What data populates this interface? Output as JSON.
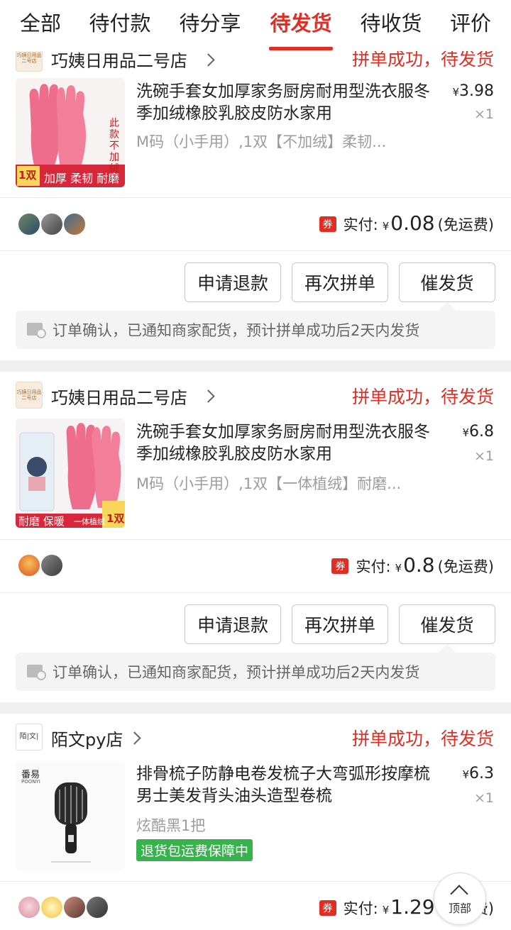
{
  "tabs": [
    {
      "label": "全部"
    },
    {
      "label": "待付款"
    },
    {
      "label": "待分享"
    },
    {
      "label": "待发货"
    },
    {
      "label": "待收货"
    },
    {
      "label": "评价"
    }
  ],
  "active_tab": "待发货",
  "colors": {
    "accent": "#e02e24",
    "guarantee": "#37b24d"
  },
  "orders": [
    {
      "shop_logo": "巧姨日用品二号店",
      "shop_name": "巧姨日用品二号店",
      "status": "拼单成功，待发货",
      "title": "洗碗手套女加厚家务厨房耐用型洗衣服冬季加绒橡胶乳胶皮防水家用",
      "spec": "M码（小手用）,1双【不加绒】柔韧...",
      "price_symbol": "¥",
      "price": "3.98",
      "qty": "×1",
      "thumb_badge": "1双",
      "thumb_banner": "加厚 柔韧 耐磨",
      "thumb_side": "此款不加绒",
      "coupon": "券",
      "paid_label": "实付:",
      "paid_symbol": "¥",
      "paid_amount": "0.08",
      "paid_note": "(免运费)",
      "buttons": [
        "申请退款",
        "再次拼单",
        "催发货"
      ],
      "notice": "订单确认，已通知商家配货，预计拼单成功后2天内发货"
    },
    {
      "shop_logo": "巧姨日用品二号店",
      "shop_name": "巧姨日用品二号店",
      "status": "拼单成功，待发货",
      "title": "洗碗手套女加厚家务厨房耐用型洗衣服冬季加绒橡胶乳胶皮防水家用",
      "spec": "M码（小手用）,1双【一体植绒】耐磨...",
      "price_symbol": "¥",
      "price": "6.8",
      "qty": "×1",
      "thumb_badge": "1双",
      "thumb_banner": "耐磨 保暖",
      "thumb_side": "一体植绒",
      "coupon": "券",
      "paid_label": "实付:",
      "paid_symbol": "¥",
      "paid_amount": "0.8",
      "paid_note": "(免运费)",
      "buttons": [
        "申请退款",
        "再次拼单",
        "催发货"
      ],
      "notice": "订单确认，已通知商家配货，预计拼单成功后2天内发货"
    },
    {
      "shop_logo": "陌|文|",
      "shop_name": "陌文py店",
      "status": "拼单成功，待发货",
      "title": "排骨梳子防静电卷发梳子大弯弧形按摩梳男士美发背头油头造型卷梳",
      "spec": "炫酷黑1把",
      "guarantee": "退货包运费保障中",
      "price_symbol": "¥",
      "price": "6.3",
      "qty": "×1",
      "thumb_brand": "番易",
      "thumb_brand_en": "POONYI",
      "coupon": "券",
      "paid_label": "实付:",
      "paid_symbol": "¥",
      "paid_amount": "1.29",
      "paid_note": "(免运费)"
    }
  ],
  "back_to_top": "顶部"
}
